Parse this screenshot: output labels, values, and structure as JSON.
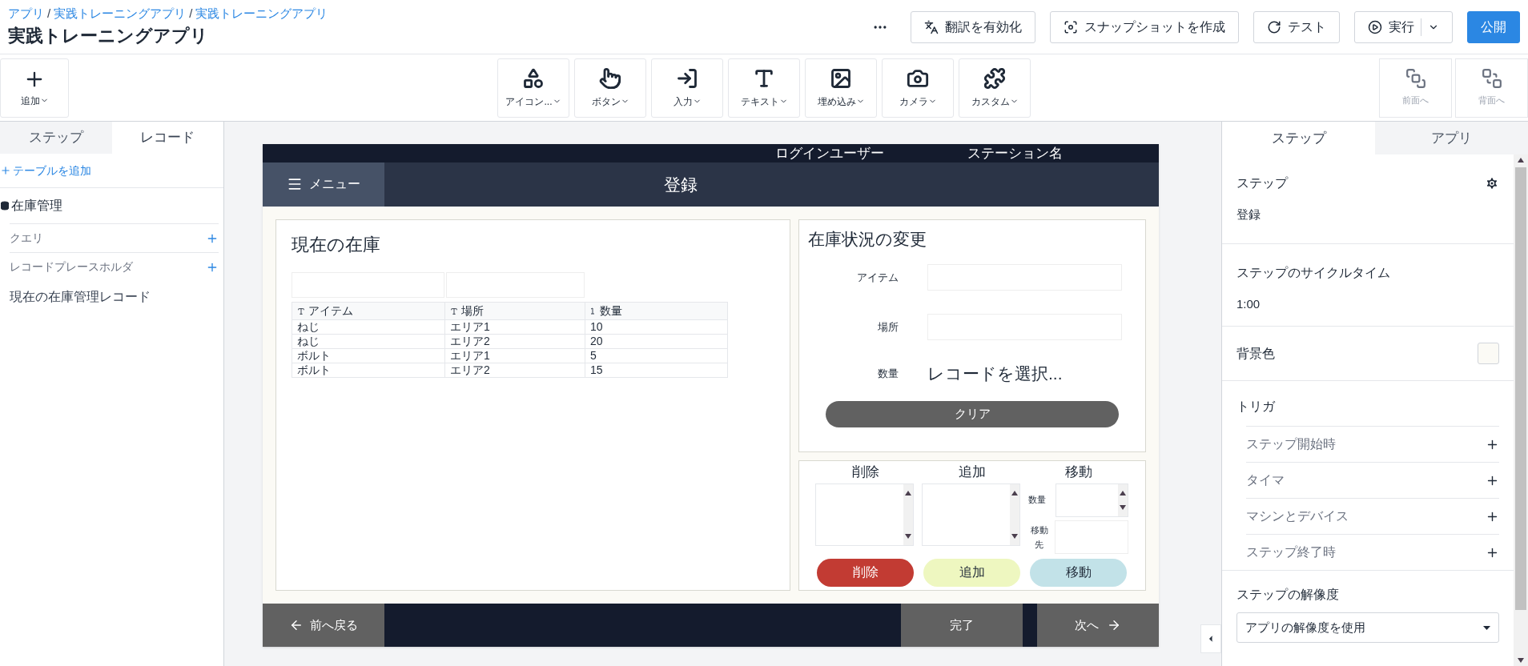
{
  "header": {
    "breadcrumb_separator": "/",
    "breadcrumb": [
      "アプリ",
      "実践トレーニングアプリ",
      "実践トレーニングアプリ"
    ],
    "title": "実践トレーニングアプリ",
    "buttons": [
      {
        "label": "翻訳を有効化",
        "kind": "outline"
      },
      {
        "label": "スナップショットを作成",
        "kind": "outline"
      },
      {
        "label": "テスト",
        "kind": "outline"
      },
      {
        "label": "実行",
        "kind": "split"
      },
      {
        "label": "公開",
        "kind": "primary"
      }
    ]
  },
  "toolbar": {
    "add": "追加",
    "tools": [
      "アイコン...",
      "ボタン",
      "入力",
      "テキスト",
      "埋め込み",
      "カメラ",
      "カスタム"
    ],
    "arrange": [
      {
        "label": "前面へ",
        "disabled": true
      },
      {
        "label": "背面へ",
        "disabled": true
      }
    ]
  },
  "left_panel": {
    "tabs": [
      {
        "label": "ステップ",
        "selected": false
      },
      {
        "label": "レコード",
        "selected": true
      }
    ],
    "add_table": "テーブルを追加",
    "table_name": "在庫管理",
    "items": [
      {
        "label": "クエリ",
        "kind": "section"
      },
      {
        "label": "レコードプレースホルダ",
        "kind": "section"
      },
      {
        "label": "現在の在庫管理レコード",
        "kind": "record"
      }
    ]
  },
  "app": {
    "top_bar": [
      "ログインユーザー",
      "ステーション名"
    ],
    "menu": "メニュー",
    "step_title": "登録",
    "inventory": {
      "title": "現在の在庫",
      "columns": [
        {
          "label": "アイテム",
          "kind": "text"
        },
        {
          "label": "場所",
          "kind": "text"
        },
        {
          "label": "数量",
          "kind": "number"
        }
      ],
      "rows": [
        [
          "ねじ",
          "エリア1",
          "10"
        ],
        [
          "ねじ",
          "エリア2",
          "20"
        ],
        [
          "ボルト",
          "エリア1",
          "5"
        ],
        [
          "ボルト",
          "エリア2",
          "15"
        ]
      ]
    },
    "change": {
      "title": "在庫状況の変更",
      "item_label": "アイテム",
      "place_label": "場所",
      "qty_label": "数量",
      "qty_value": "レコードを選択...",
      "clear": "クリア"
    },
    "actions": [
      {
        "title": "削除",
        "button": "削除",
        "color": "#c23b33"
      },
      {
        "title": "追加",
        "button": "追加",
        "color": "#eef7c0"
      },
      {
        "title": "移動",
        "button": "移動",
        "color": "#c2e2e8"
      }
    ],
    "move_qty_label": "数量",
    "move_dest_label": "移動先",
    "footer": {
      "back": "前へ戻る",
      "done": "完了",
      "next": "次へ"
    }
  },
  "right_panel": {
    "tabs": [
      {
        "label": "ステップ",
        "selected": true
      },
      {
        "label": "アプリ",
        "selected": false
      }
    ],
    "step_label": "ステップ",
    "step_value": "登録",
    "cycle_label": "ステップのサイクルタイム",
    "cycle_value": "1:00",
    "bg_label": "背景色",
    "bg_swatch": {
      "color": "#fbfaf5"
    },
    "trigger_label": "トリガ",
    "triggers": [
      "ステップ開始時",
      "タイマ",
      "マシンとデバイス",
      "ステップ終了時"
    ],
    "resolution_label": "ステップの解像度",
    "resolution_value": "アプリの解像度を使用"
  }
}
